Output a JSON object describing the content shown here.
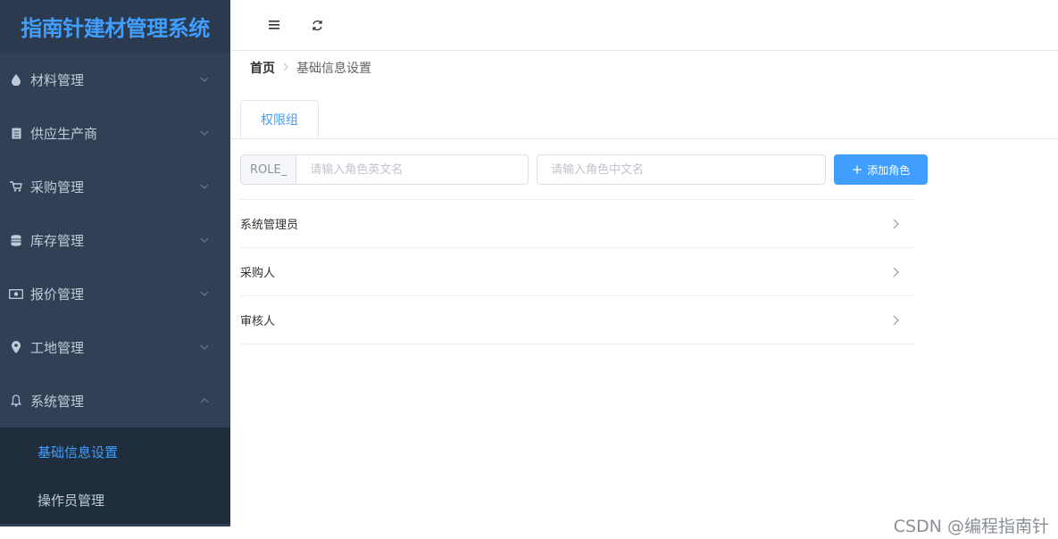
{
  "app": {
    "title": "指南针建材管理系统"
  },
  "colors": {
    "accent": "#409eff",
    "sidebar_bg": "#304156",
    "submenu_bg": "#1f2d3d",
    "sidebar_text": "#bfcbd9"
  },
  "sidebar": {
    "menus": [
      {
        "label": "材料管理",
        "icon": "drop-icon",
        "expanded": false
      },
      {
        "label": "供应生产商",
        "icon": "document-icon",
        "expanded": false
      },
      {
        "label": "采购管理",
        "icon": "cart-icon",
        "expanded": false
      },
      {
        "label": "库存管理",
        "icon": "database-icon",
        "expanded": false
      },
      {
        "label": "报价管理",
        "icon": "money-icon",
        "expanded": false
      },
      {
        "label": "工地管理",
        "icon": "location-icon",
        "expanded": false
      },
      {
        "label": "系统管理",
        "icon": "bell-icon",
        "expanded": true
      }
    ],
    "submenu": [
      {
        "label": "基础信息设置",
        "active": true
      },
      {
        "label": "操作员管理",
        "active": false
      }
    ]
  },
  "topbar": {
    "icons": [
      "hamburger-icon",
      "refresh-icon"
    ]
  },
  "breadcrumb": {
    "home": "首页",
    "current": "基础信息设置"
  },
  "tabs": [
    {
      "label": "权限组",
      "active": true
    }
  ],
  "form": {
    "prefix": "ROLE_",
    "en_placeholder": "请输入角色英文名",
    "cn_placeholder": "请输入角色中文名",
    "add_button": "添加角色"
  },
  "roles": [
    {
      "name": "系统管理员"
    },
    {
      "name": "采购人"
    },
    {
      "name": "审核人"
    }
  ],
  "watermark": "CSDN @编程指南针"
}
